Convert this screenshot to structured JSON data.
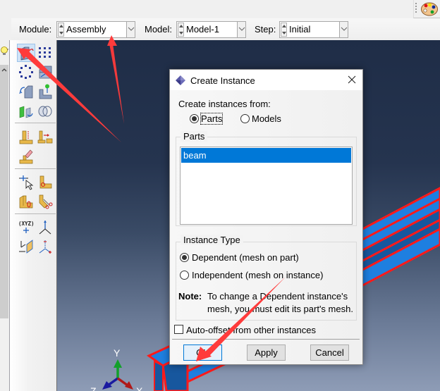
{
  "context_bar": {
    "module_label": "Module:",
    "module_value": "Assembly",
    "model_label": "Model:",
    "model_value": "Model-1",
    "step_label": "Step:",
    "step_value": "Initial"
  },
  "toolbox": {
    "tools": [
      {
        "name": "create-instance",
        "active": true
      },
      {
        "name": "linear-pattern"
      },
      {
        "name": "radial-pattern"
      },
      {
        "name": "translate-instance"
      },
      {
        "name": "rotate-instance"
      },
      {
        "name": "translate-to"
      },
      {
        "name": "replace-instances"
      },
      {
        "name": "merge-cut-instances"
      },
      {
        "name": "create-constraint-parallel-face"
      },
      {
        "name": "create-constraint-face-to-face"
      },
      {
        "name": "constraint-manager"
      },
      {
        "name": "create-datum-point"
      },
      {
        "name": "create-set"
      },
      {
        "name": "partition-cell"
      },
      {
        "name": "partition-cut"
      },
      {
        "name": "create-datum-csys"
      },
      {
        "name": "create-datum-axis"
      },
      {
        "name": "create-datum-plane"
      },
      {
        "name": "create-reference-point"
      }
    ]
  },
  "viewport": {
    "triad": {
      "y_label": "Y",
      "z_label": "Z",
      "x_label": "X"
    },
    "colors": {
      "beam_face": "#1e7fe0",
      "beam_dark": "#17579e",
      "beam_edge": "#ff1a1a"
    }
  },
  "dialog": {
    "title": "Create Instance",
    "create_from_label": "Create instances from:",
    "source_options": [
      {
        "label": "Parts",
        "selected": true
      },
      {
        "label": "Models",
        "selected": false
      }
    ],
    "parts_group_title": "Parts",
    "parts": [
      {
        "label": "beam",
        "selected": true
      }
    ],
    "instance_type_title": "Instance Type",
    "instance_types": [
      {
        "label": "Dependent (mesh on part)",
        "selected": true
      },
      {
        "label": "Independent (mesh on instance)",
        "selected": false
      }
    ],
    "note_label": "Note:",
    "note_line1": "To change a Dependent instance's",
    "note_line2": "mesh, you must edit its part's mesh.",
    "auto_offset_label": "Auto-offset from other instances",
    "auto_offset_checked": false,
    "buttons": {
      "ok": "OK",
      "apply": "Apply",
      "cancel": "Cancel"
    }
  },
  "annotations": {
    "arrow_color": "#ff3b3b"
  }
}
